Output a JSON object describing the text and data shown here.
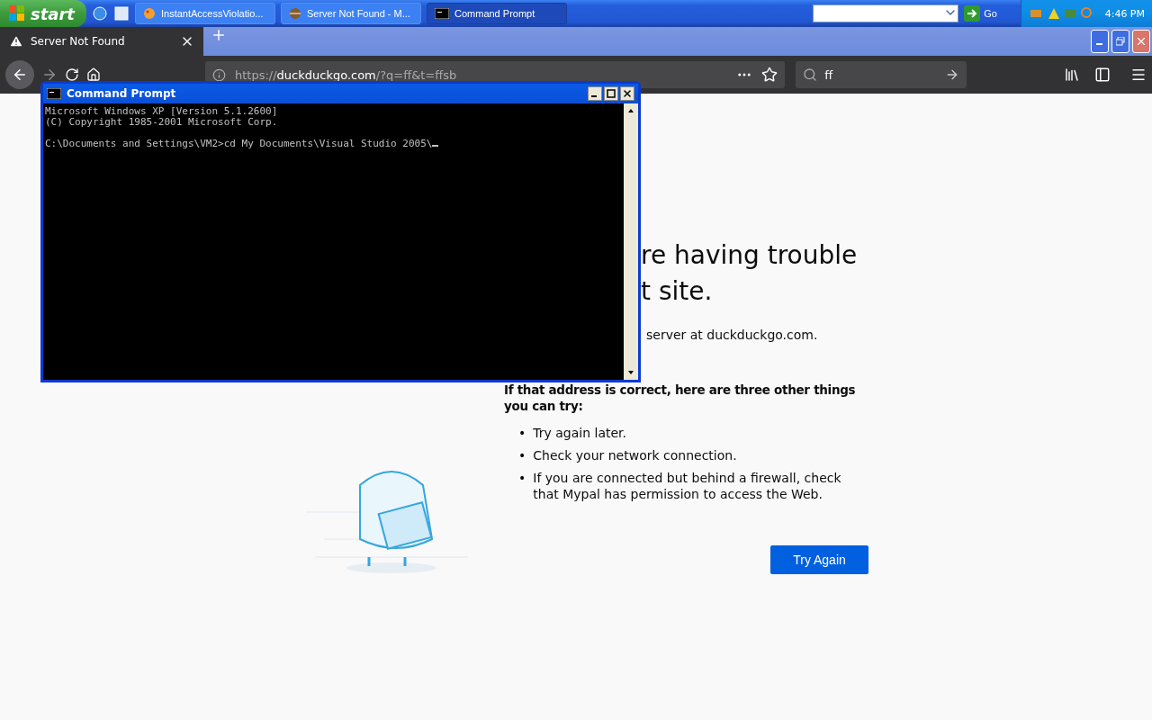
{
  "taskbar": {
    "start": "start",
    "tasks": [
      {
        "label": "InstantAccessViolatio...",
        "kind": "paint",
        "selected": false
      },
      {
        "label": "Server Not Found - M...",
        "kind": "browser",
        "selected": false
      },
      {
        "label": "Command Prompt",
        "kind": "console",
        "selected": true
      }
    ],
    "go": "Go",
    "clock": "4:46 PM"
  },
  "browser": {
    "tabs": [
      {
        "title": "Server Not Found",
        "selected": true
      }
    ],
    "url": {
      "scheme": "https://",
      "host": "duckduckgo.com",
      "path": "/?q=ff&t=ffsb"
    },
    "search": {
      "value": "ff"
    }
  },
  "page": {
    "heading_lines": [
      "re having trouble",
      "t site."
    ],
    "detail": "server at duckduckgo.com.",
    "subheading": "If that address is correct, here are three other things you can try:",
    "items": [
      {
        "marker": "•",
        "text": "Try again later."
      },
      {
        "marker": "•",
        "text": "Check your network connection."
      },
      {
        "marker": "•",
        "text": "If you are connected but behind a firewall, check that Mypal has permission to access the Web."
      }
    ],
    "button": "Try Again"
  },
  "console": {
    "title": "Command Prompt",
    "paragraphs": [
      [
        "Microsoft Windows XP [Version 5.1.2600]",
        "(C) Copyright 1985-2001 Microsoft Corp."
      ],
      [
        "C:\\Documents and Settings\\VM2>cd My Documents\\Visual Studio 2005\\"
      ]
    ]
  }
}
